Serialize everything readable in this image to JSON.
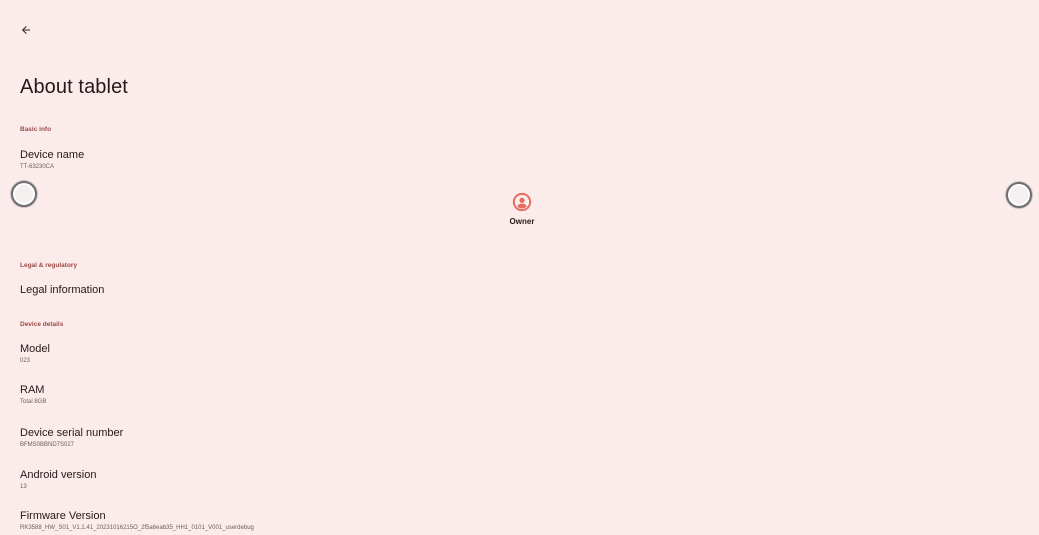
{
  "header": {
    "back_icon": "arrow-back-icon",
    "title": "About tablet"
  },
  "sections": {
    "basic_info": "Basic info",
    "legal": "Legal & regulatory",
    "device_details": "Device details"
  },
  "device_name": {
    "title": "Device name",
    "value": "TT-63230CA"
  },
  "owner": {
    "icon": "account-circle-icon",
    "label": "Owner",
    "accent_color": "#e56b60"
  },
  "legal_information": {
    "title": "Legal information"
  },
  "model": {
    "title": "Model",
    "value": "023"
  },
  "ram": {
    "title": "RAM",
    "value": "Total 8GB"
  },
  "serial": {
    "title": "Device serial number",
    "value": "BFMS0BBND7S027"
  },
  "android_version": {
    "title": "Android version",
    "value": "13"
  },
  "firmware": {
    "title": "Firmware Version",
    "value": "RK3588_HW_S01_V1.1.41_20231016215O_2f5a6eab35_HH1_0101_V001_userdebug"
  },
  "colors": {
    "background": "#fbeceb",
    "section_header": "#9b4a45",
    "text_primary": "#231918",
    "text_secondary": "#6a5d5b"
  }
}
